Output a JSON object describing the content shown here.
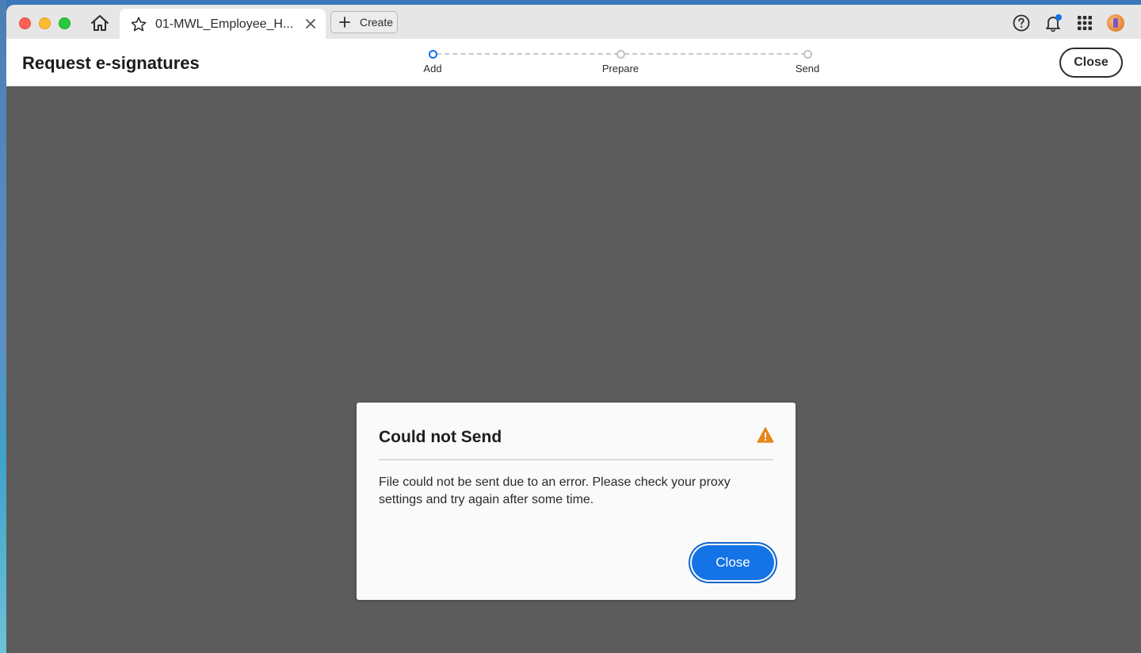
{
  "tabbar": {
    "tab_title": "01-MWL_Employee_H...",
    "create_label": "Create"
  },
  "header": {
    "title": "Request e-signatures",
    "close_label": "Close",
    "steps": [
      {
        "label": "Add",
        "active": true
      },
      {
        "label": "Prepare",
        "active": false
      },
      {
        "label": "Send",
        "active": false
      }
    ]
  },
  "dialog": {
    "title": "Could not Send",
    "message": "File could not be sent due to an error. Please check your proxy settings and try again after some time.",
    "close_label": "Close",
    "icon": "warning-icon"
  },
  "colors": {
    "accent": "#1473e6",
    "warning": "#e68619",
    "backdrop": "#5c5c5c"
  },
  "icons": [
    "home-icon",
    "star-icon",
    "close-icon",
    "plus-icon",
    "help-icon",
    "bell-icon",
    "apps-grid-icon",
    "warning-icon"
  ]
}
